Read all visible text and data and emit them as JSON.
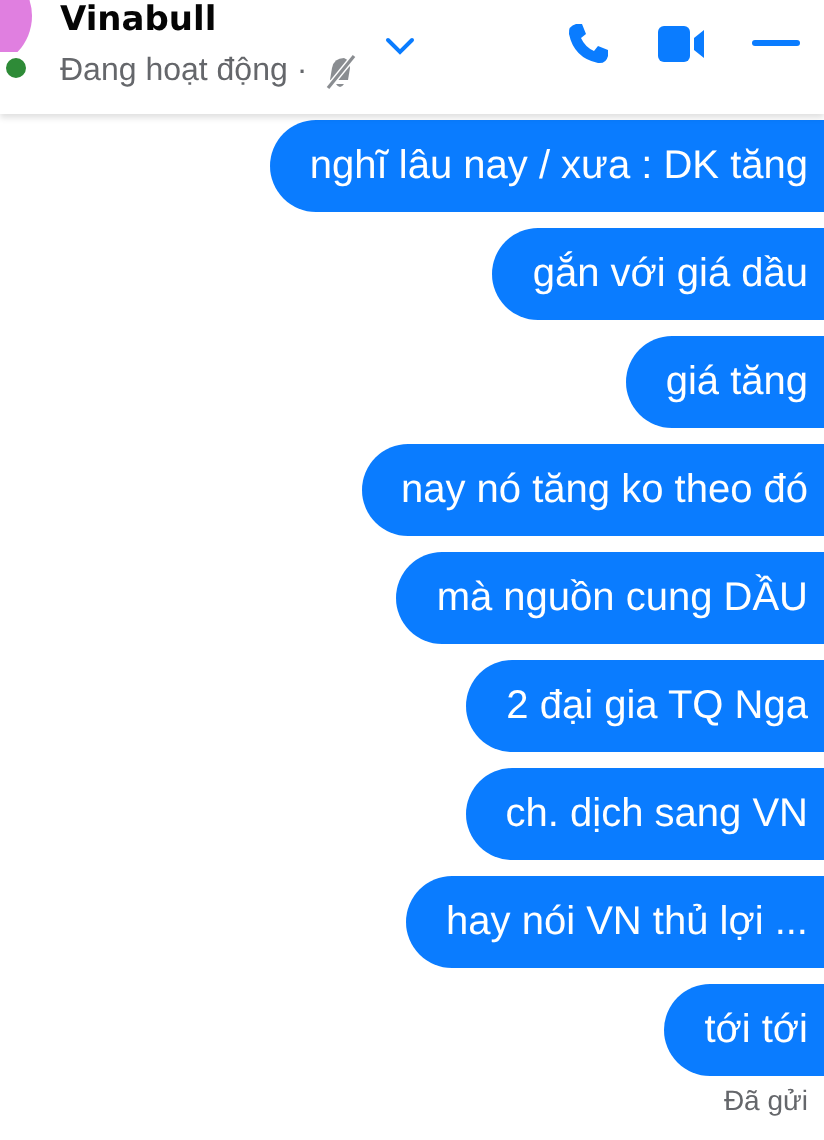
{
  "header": {
    "name": "Vinabull",
    "status": "Đang hoạt động ·",
    "online": true,
    "muted": true
  },
  "messages": [
    {
      "text": "nghĩ lâu nay / xưa : DK tăng"
    },
    {
      "text": "gắn với giá dầu"
    },
    {
      "text": "giá tăng"
    },
    {
      "text": "nay nó tăng ko theo đó"
    },
    {
      "text": "mà nguồn cung DẦU"
    },
    {
      "text": "2 đại gia TQ Nga"
    },
    {
      "text": "ch. dịch sang VN"
    },
    {
      "text": "hay nói VN thủ lợi ..."
    },
    {
      "text": "tới tới"
    }
  ],
  "receipt": "Đã gửi"
}
